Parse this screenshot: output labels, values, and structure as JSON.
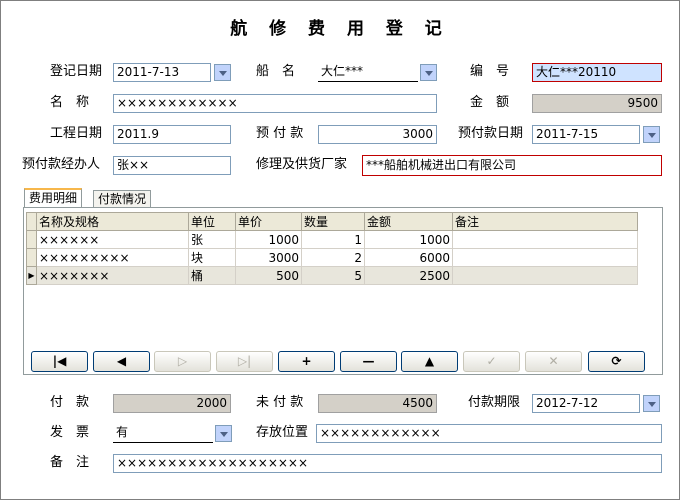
{
  "title": "航 修 费 用 登 记",
  "labels": {
    "reg_date": "登记日期",
    "ship": "船　名",
    "number": "编　号",
    "name": "名　称",
    "amount": "金　额",
    "project_date": "工程日期",
    "prepay": "预 付 款",
    "prepay_date": "预付款日期",
    "prepay_handler": "预付款经办人",
    "supplier": "修理及供货厂家",
    "paid": "付　款",
    "unpaid": "未 付 款",
    "pay_deadline": "付款期限",
    "invoice": "发　票",
    "storage": "存放位置",
    "remark": "备　注"
  },
  "fields": {
    "reg_date": "2011-7-13",
    "ship": "大仁***",
    "number": "大仁***20110",
    "name": "××××××××××××",
    "amount": "9500",
    "project_date": "2011.9",
    "prepay": "3000",
    "prepay_date": "2011-7-15",
    "prepay_handler": "张××",
    "supplier": "***船舶机械进出口有限公司",
    "paid": "2000",
    "unpaid": "4500",
    "pay_deadline": "2012-7-12",
    "invoice": "有",
    "storage": "××××××××××××",
    "remark": "×××××××××××××××××××"
  },
  "tabs": [
    "费用明细",
    "付款情况"
  ],
  "grid": {
    "headers": [
      "名称及规格",
      "单位",
      "单价",
      "数量",
      "金额",
      "备注"
    ],
    "rows": [
      [
        "××××××",
        "张",
        "1000",
        "1",
        "1000",
        ""
      ],
      [
        "×××××××××",
        "块",
        "3000",
        "2",
        "6000",
        ""
      ],
      [
        "×××××××",
        "桶",
        "500",
        "5",
        "2500",
        ""
      ]
    ]
  },
  "nav_icons": [
    "first-icon",
    "prev-icon",
    "next-icon",
    "last-icon",
    "add-icon",
    "delete-icon",
    "up-icon",
    "save-icon",
    "cancel-icon",
    "refresh-icon"
  ]
}
